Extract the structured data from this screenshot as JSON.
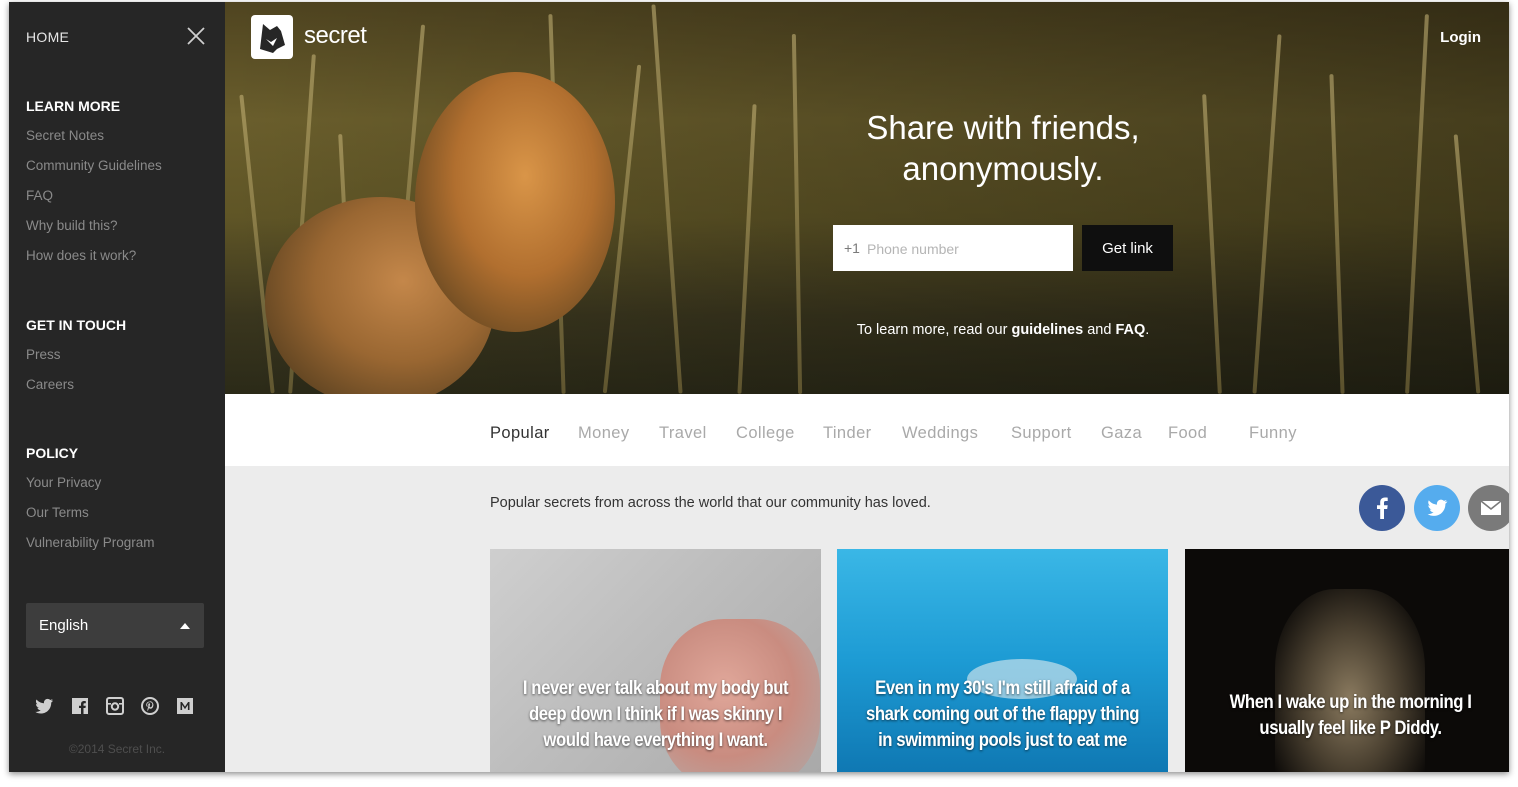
{
  "sidebar": {
    "home_label": "HOME",
    "sections": [
      {
        "heading": "LEARN MORE",
        "links": [
          "Secret Notes",
          "Community Guidelines",
          "FAQ",
          "Why build this?",
          "How does it work?"
        ]
      },
      {
        "heading": "GET IN TOUCH",
        "links": [
          "Press",
          "Careers"
        ]
      },
      {
        "heading": "POLICY",
        "links": [
          "Your Privacy",
          "Our Terms",
          "Vulnerability Program"
        ]
      }
    ],
    "language": {
      "selected": "English"
    },
    "social_icons": [
      "twitter-icon",
      "facebook-icon",
      "instagram-icon",
      "pinterest-icon",
      "medium-icon"
    ],
    "copyright": "©2014 Secret Inc."
  },
  "header": {
    "logo_text": "secret",
    "login_label": "Login"
  },
  "hero": {
    "headline_line1": "Share with friends,",
    "headline_line2": "anonymously.",
    "country_code": "+1",
    "phone_placeholder": "Phone number",
    "get_link_label": "Get link",
    "learn_prefix": "To learn more, read our ",
    "learn_guidelines": "guidelines",
    "learn_and": " and ",
    "learn_faq": "FAQ",
    "learn_suffix": "."
  },
  "tabs": [
    "Popular",
    "Money",
    "Travel",
    "College",
    "Tinder",
    "Weddings",
    "Support",
    "Gaza",
    "Food",
    "Funny"
  ],
  "active_tab": "Popular",
  "feed": {
    "intro": "Popular secrets from across the world that our community has loved.",
    "share_buttons": [
      {
        "icon": "facebook-icon",
        "color": "#3b5998"
      },
      {
        "icon": "twitter-icon",
        "color": "#55acee"
      },
      {
        "icon": "email-icon",
        "color": "#7a7a7a"
      }
    ],
    "cards": [
      {
        "text": "I never ever talk about my body but deep down I think if I was skinny I would have everything I want."
      },
      {
        "text": "Even in my 30's I'm still afraid of a shark coming out of the flappy thing in swimming pools just to eat me"
      },
      {
        "text": "When I wake up in the morning I usually feel like P Diddy."
      }
    ]
  },
  "colors": {
    "sidebar_bg": "#262626",
    "content_bg": "#ececec",
    "button_dark": "#0f0f0f",
    "facebook": "#3b5998",
    "twitter": "#55acee"
  }
}
